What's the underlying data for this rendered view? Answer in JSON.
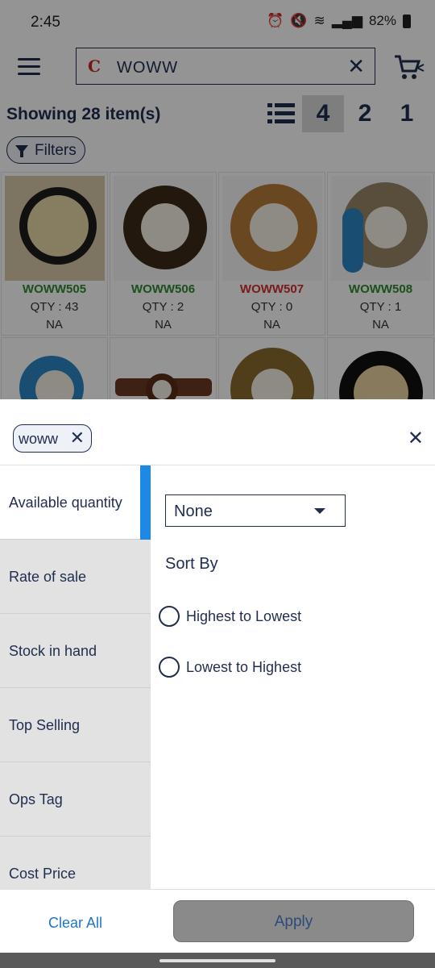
{
  "status_bar": {
    "time": "2:45",
    "battery": "82%"
  },
  "app_bar": {
    "search_value": "WOWW",
    "search_logo": "C"
  },
  "results": {
    "count_text": "Showing 28 item(s)",
    "view_options": [
      "4",
      "2",
      "1"
    ],
    "active_view": "4"
  },
  "filters_chip": {
    "label": "Filters"
  },
  "products": [
    {
      "code": "WOWW505",
      "qty": "QTY : 43",
      "na": "NA",
      "code_color": "#2e8b2e"
    },
    {
      "code": "WOWW506",
      "qty": "QTY : 2",
      "na": "NA",
      "code_color": "#2e8b2e"
    },
    {
      "code": "WOWW507",
      "qty": "QTY : 0",
      "na": "NA",
      "code_color": "#d32f2f"
    },
    {
      "code": "WOWW508",
      "qty": "QTY : 1",
      "na": "NA",
      "code_color": "#2e8b2e"
    }
  ],
  "filter_sheet": {
    "active_tag": "woww",
    "categories": [
      {
        "label": "Available quantity",
        "active": true
      },
      {
        "label": "Rate of sale",
        "active": false
      },
      {
        "label": "Stock in hand",
        "active": false
      },
      {
        "label": "Top Selling",
        "active": false
      },
      {
        "label": "Ops Tag",
        "active": false
      },
      {
        "label": "Cost Price",
        "active": false
      }
    ],
    "select_value": "None",
    "sort_title": "Sort By",
    "sort_options": [
      "Highest to Lowest",
      "Lowest to Highest"
    ],
    "clear_all_label": "Clear All",
    "apply_label": "Apply"
  },
  "colors": {
    "accent": "#1e88e5",
    "primary": "#1f2d4f",
    "link": "#1e76c6",
    "apply_bg": "#8a8a8a"
  }
}
